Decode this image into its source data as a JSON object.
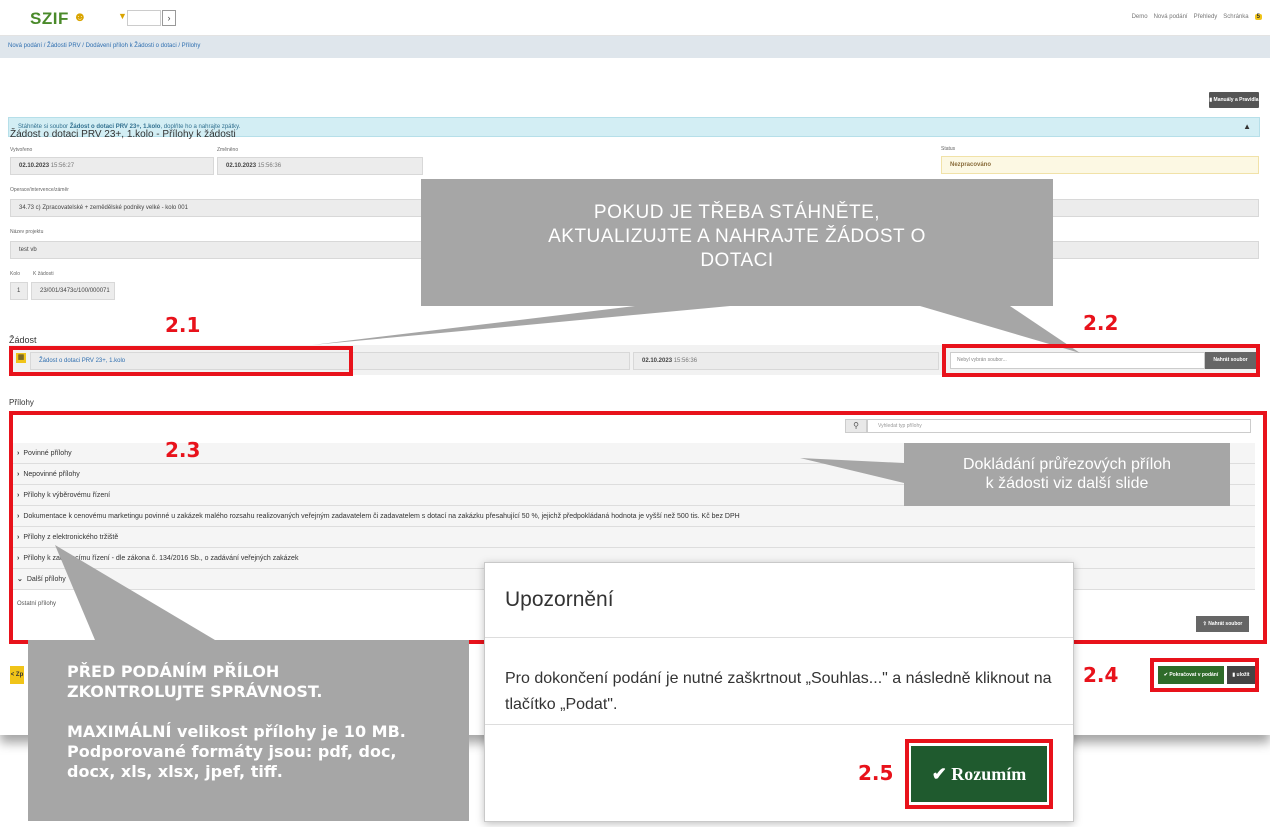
{
  "app": {
    "logo": "SZIF",
    "logo_icon": "user-icon",
    "dropdown_icon": "chevron-down-icon",
    "go_icon": "chevron-right-icon",
    "nav": [
      "Demo",
      "Nová podání",
      "Přehledy",
      "Schránka"
    ],
    "inbox_count": "5"
  },
  "breadcrumb": "Nová podání / Žádosti PRV / Dodávení příloh k Žádosti o dotaci / Přílohy",
  "manual_button": "Manuály a Pravidla PRV",
  "info_bar": {
    "prefix": "Stáhněte si soubor ",
    "file": "Žádost o dotaci PRV 23+, 1.kolo",
    "suffix": ", doplňte ho a nahrajte zpátky.",
    "pin_icon": "pin-icon"
  },
  "form": {
    "title": "Žádost o dotaci PRV 23+, 1.kolo - Přílohy k žádosti",
    "created_label": "Vytvořeno",
    "created_date": "02.10.2023",
    "created_time": "15:56:27",
    "changed_label": "Změněno",
    "changed_date": "02.10.2023",
    "changed_time": "15:56:36",
    "status_label": "Status",
    "status_value": "Nezpracováno",
    "operation_label": "Operace/intervence/záměr",
    "operation_value": "34.73 c) Zpracovatelské + zemědělské podniky velké - kolo 001",
    "project_label": "Název projektu",
    "project_value": "test vb",
    "kolo_label": "Kolo",
    "kolo_value": "1",
    "ref_label": "K žádosti",
    "ref_value": "23/001/3473c/100/000071"
  },
  "zadost": {
    "title": "Žádost",
    "file_icon": "file-icon",
    "file_name": "Žádost o dotaci PRV 23+, 1.kolo",
    "file_date": "02.10.2023",
    "file_time": "15:56:36",
    "file_input_placeholder": "Nebyl vybrán soubor...",
    "upload_button": "Nahrát soubor"
  },
  "prilohy": {
    "title": "Přílohy",
    "search_icon": "search-icon",
    "search_placeholder": "Vyhledat typ přílohy",
    "sections": [
      {
        "label": "Povinné přílohy",
        "caret": "›"
      },
      {
        "label": "Nepovinné přílohy",
        "caret": "›"
      },
      {
        "label": "Přílohy k výběrovému řízení",
        "caret": "›"
      },
      {
        "label": "Dokumentace k cenovému marketingu povinné u zakázek malého rozsahu realizovaných veřejným zadavatelem či zadavatelem s dotací na zakázku přesahující 50 %, jejichž předpokládaná hodnota je vyšší než 500 tis. Kč bez DPH",
        "caret": "›"
      },
      {
        "label": "Přílohy z elektronického tržiště",
        "caret": "›"
      },
      {
        "label": "Přílohy k zadávacímu řízení - dle zákona č. 134/2016 Sb., o zadávání veřejných zakázek",
        "caret": "›"
      },
      {
        "label": "Další přílohy",
        "caret": "⌄"
      }
    ],
    "other_label": "Ostatní přílohy",
    "upload_button": "Nahrát soubor"
  },
  "footer": {
    "back_label": "< Zp",
    "continue_button": "Pokračovat v podání",
    "save_button": "uložit"
  },
  "annotations": {
    "labels": [
      "2.1",
      "2.2",
      "2.3",
      "2.4",
      "2.5"
    ],
    "callout_top": [
      "POKUD JE TŘEBA STÁHNĚTE,",
      "AKTUALIZUJTE A NAHRAJTE ŽÁDOST O",
      "DOTACI"
    ],
    "callout_right": [
      "Dokládání průřezových příloh",
      "k žádosti viz další slide"
    ],
    "callout_left_1": [
      "PŘED PODÁNÍM PŘÍLOH",
      "ZKONTROLUJTE SPRÁVNOST."
    ],
    "callout_left_2": [
      "MAXIMÁLNÍ velikost přílohy je 10 MB.",
      "Podporované formáty jsou: pdf, doc,",
      "docx, xls, xlsx, jpef, tiff."
    ]
  },
  "modal": {
    "title": "Upozornění",
    "body": "Pro dokončení podání je nutné zaškrtnout „Souhlas...\" a následně kliknout na tlačítko „Podat\".",
    "button": "Rozumím",
    "button_icon": "check-icon"
  },
  "colors": {
    "annotation_red": "#e8121b",
    "callout_gray": "#a6a6a6",
    "primary_green": "#1f5a2e",
    "brand_green": "#4a8a2a",
    "accent_yellow": "#f0c419"
  }
}
